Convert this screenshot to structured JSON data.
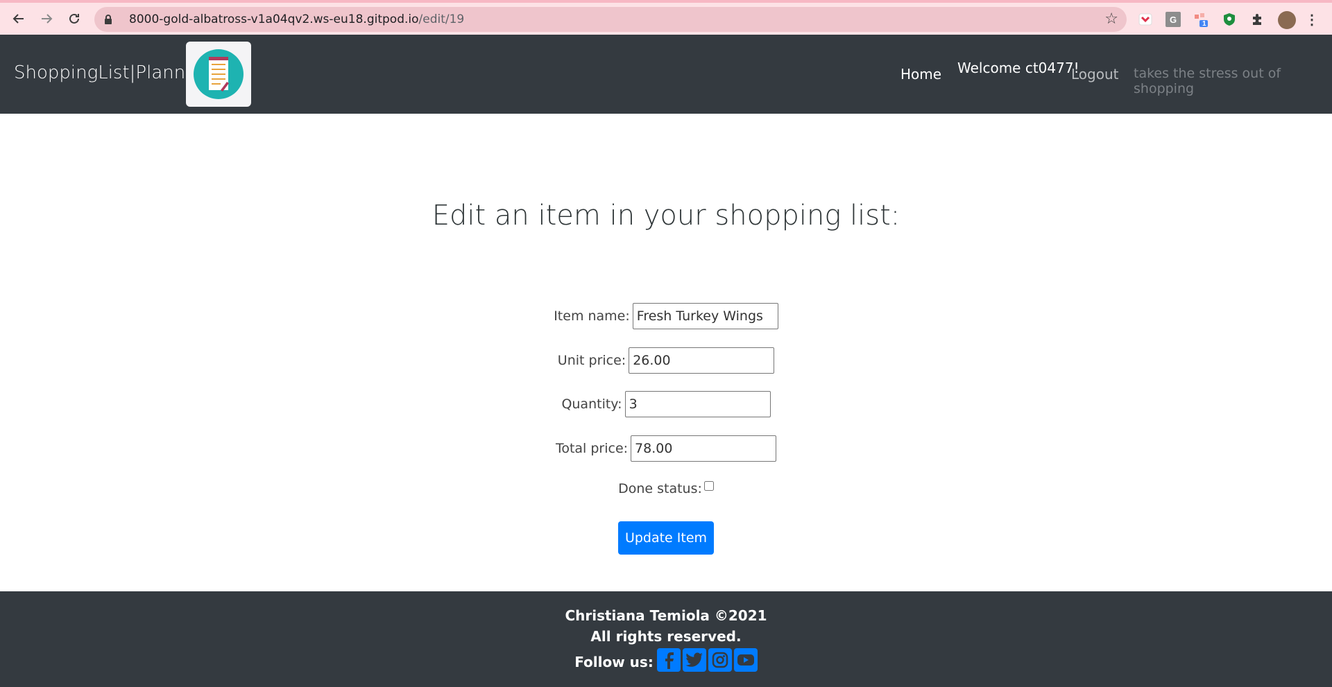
{
  "browser": {
    "url_host": "8000-gold-albatross-v1a04qv2.ws-eu18.gitpod.io",
    "url_path": "/edit/19",
    "extension_badge": "1",
    "grammarly_letter": "G"
  },
  "nav": {
    "brand": "ShoppingList|Planner",
    "home": "Home",
    "welcome": "Welcome ct0477!",
    "logout": "Logout",
    "tagline": "takes the stress out of shopping"
  },
  "main": {
    "title": "Edit an item in your shopping list:",
    "form": {
      "item_name_label": "Item name:",
      "item_name_value": "Fresh Turkey Wings",
      "unit_price_label": "Unit price:",
      "unit_price_value": "26.00",
      "quantity_label": "Quantity:",
      "quantity_value": "3",
      "total_price_label": "Total price:",
      "total_price_value": "78.00",
      "done_status_label": "Done status:",
      "done_checked": false,
      "submit_label": "Update Item"
    }
  },
  "footer": {
    "copyright": "Christiana Temiola ©2021",
    "rights": "All rights reserved.",
    "follow": "Follow us:",
    "social_icons": [
      "facebook-icon",
      "twitter-icon",
      "instagram-icon",
      "youtube-icon"
    ]
  },
  "colors": {
    "navbar": "#343a40",
    "primary": "#007bff",
    "browser_tint": "#fde2e6"
  }
}
